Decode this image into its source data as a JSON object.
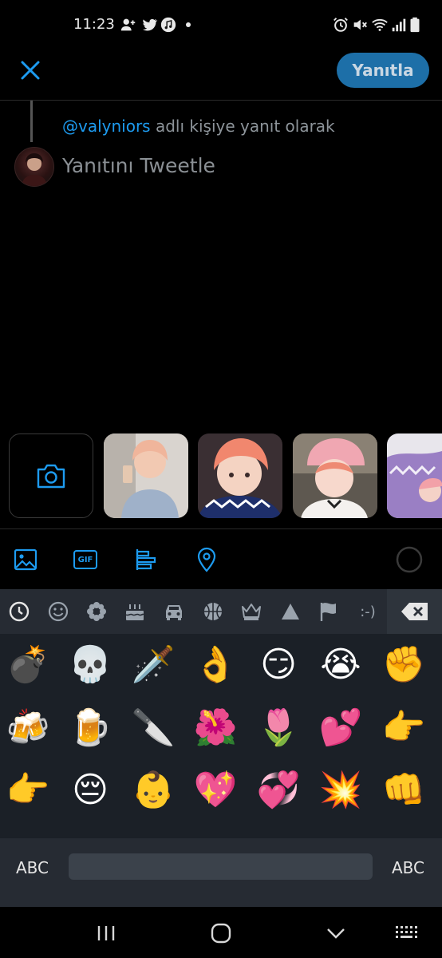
{
  "status_bar": {
    "time": "11:23",
    "left_icons": [
      "person-add-icon",
      "twitter-bird-icon",
      "music-icon",
      "dot-icon"
    ],
    "right_icons": [
      "alarm-icon",
      "mute-icon",
      "wifi-icon",
      "signal-icon",
      "battery-icon"
    ]
  },
  "header": {
    "close_icon": "close-icon",
    "reply_button_label": "Yanıtla"
  },
  "reply": {
    "handle": "@valyniors",
    "context_text": " adlı kişiye yanıt olarak",
    "compose_placeholder": "Yanıtını Tweetle"
  },
  "media_row": {
    "camera_icon": "camera-icon",
    "photo_count": 4
  },
  "toolbar": {
    "items": [
      "image-icon",
      "gif-icon",
      "poll-icon",
      "location-icon"
    ],
    "gif_label": "GIF"
  },
  "keyboard": {
    "emoji_tabs": [
      "recent-icon",
      "smiley-icon",
      "flower-icon",
      "cake-icon",
      "car-icon",
      "basketball-icon",
      "crown-icon",
      "triangle-icon",
      "flag-icon",
      "emoticon-icon"
    ],
    "emoticon_label": ":-)",
    "emoji_rows": [
      [
        "💣",
        "💀",
        "🗡️",
        "👌",
        "😏",
        "😭",
        "✊"
      ],
      [
        "🍻",
        "🍺",
        "🔪",
        "🌺",
        "🌷",
        "💕",
        "👉"
      ],
      [
        "👉",
        "😔",
        "👶",
        "💖",
        "💞",
        "💥",
        "👊"
      ]
    ],
    "left_mode_label": "ABC",
    "right_mode_label": "ABC"
  },
  "nav_bar": {
    "items": [
      "recents-icon",
      "home-icon",
      "back-icon",
      "keyboard-toggle-icon"
    ]
  },
  "colors": {
    "accent": "#1d9bf0",
    "reply_button_bg": "#1d6fa8",
    "keyboard_bg": "#1b2027"
  }
}
